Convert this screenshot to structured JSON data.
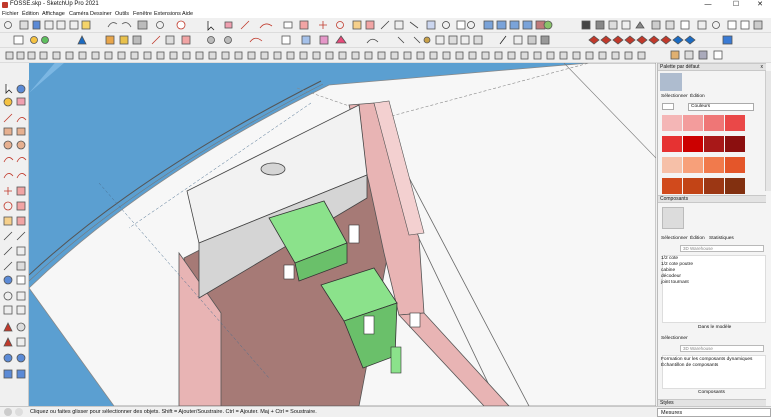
{
  "window": {
    "title": "FOSSE.skp - SketchUp Pro 2021",
    "minimize": "—",
    "maximize": "☐",
    "close": "✕"
  },
  "menu": [
    "Fichier",
    "Édition",
    "Affichage",
    "Caméra",
    "Dessiner",
    "Outils",
    "Fenêtre",
    "Extensions",
    "Aide"
  ],
  "tray": {
    "title": "Palette par défaut",
    "close": "x",
    "materials_tabs": [
      "Sélectionner",
      "Édition"
    ],
    "materials_dropdown": "Couleurs",
    "swatch_colors": [
      "#f4b6b6",
      "#f39c9c",
      "#ef7676",
      "#ea4848",
      "#e63232",
      "#cc0000",
      "#a81818",
      "#8b0f0f",
      "#f6c0a8",
      "#f7a07a",
      "#f17a4c",
      "#e4562a",
      "#d14a1c",
      "#c24416",
      "#9c3714",
      "#823010"
    ],
    "components_header": "Composants",
    "components_tabs": [
      "Sélectionner",
      "Édition",
      "Statistiques"
    ],
    "search_placeholder": "3D Warehouse",
    "component_items": [
      "1/2 cote",
      "1/2 cote poutre",
      "cabine",
      "décodeur",
      "joint tournant"
    ],
    "in_model_label": "Dans le modèle",
    "selection_label": "Sélectionner",
    "search_placeholder_2": "3D Warehouse",
    "links": [
      "Formation sur les composants dynamiques",
      "Échantillon de composants"
    ],
    "components_footer": "Composants",
    "styles_header": "Styles"
  },
  "status": {
    "text": "Cliquez ou faites glisser pour sélectionner des objets. Shift = Ajouter/Soustraire. Ctrl = Ajouter. Maj + Ctrl = Soustraire.",
    "measures_label": "Mesures"
  },
  "colors": {
    "sky": "#5b9fd1",
    "hull_white": "#f7f7f7",
    "deck_gray": "#d5d5d5",
    "wall_pink": "#e8b4b4",
    "wall_brown": "#a67a76",
    "servo_green": "#8be28b",
    "accent_blue": "#1b6bc2"
  }
}
